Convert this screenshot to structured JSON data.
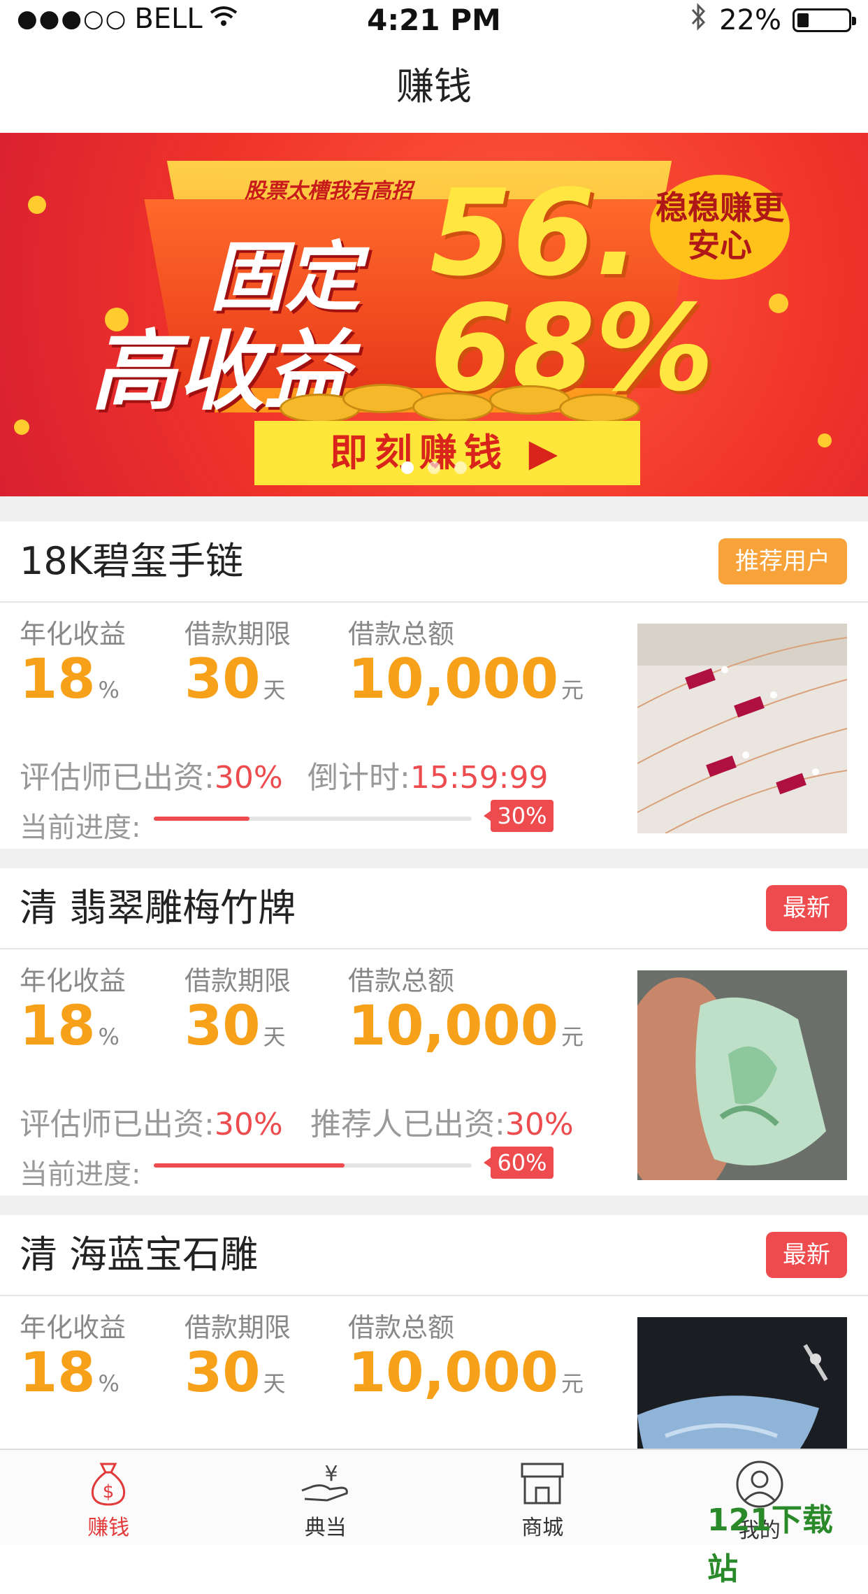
{
  "status_bar": {
    "signal": "●●●○○",
    "carrier": "BELL",
    "time": "4:21 PM",
    "battery": "22%"
  },
  "nav": {
    "title": "赚钱"
  },
  "banner": {
    "slogan": "股票太槽我有高招",
    "line1": "固定",
    "line2": "高收益",
    "rate_top": "56.",
    "rate_bottom": "68%",
    "bubble": "稳稳赚更安心",
    "button": "即刻赚钱 ▶",
    "pages": 3,
    "active_page": 0
  },
  "labels": {
    "annual_return": "年化收益",
    "loan_term": "借款期限",
    "loan_total": "借款总额",
    "progress": "当前进度:"
  },
  "products": [
    {
      "title": "18K碧玺手链",
      "tag": "推荐用户",
      "tag_color": "#f8a23a",
      "annual_return": "18",
      "annual_unit": "%",
      "term": "30",
      "term_unit": "天",
      "total": "10,000",
      "total_unit": "元",
      "info_left_label": "评估师已出资:",
      "info_left_value": "30%",
      "info_right_label": "倒计时:",
      "info_right_value": "15:59:99",
      "progress": 0.3,
      "progress_label": "30%",
      "image": "bracelet-photo"
    },
    {
      "title": "清 翡翠雕梅竹牌",
      "tag": "最新",
      "tag_color": "#ee4b4f",
      "annual_return": "18",
      "annual_unit": "%",
      "term": "30",
      "term_unit": "天",
      "total": "10,000",
      "total_unit": "元",
      "info_left_label": "评估师已出资:",
      "info_left_value": "30%",
      "info_right_label": "推荐人已出资:",
      "info_right_value": "30%",
      "progress": 0.6,
      "progress_label": "60%",
      "image": "jade-pendant-photo"
    },
    {
      "title": "清 海蓝宝石雕",
      "tag": "最新",
      "tag_color": "#ee4b4f",
      "annual_return": "18",
      "annual_unit": "%",
      "term": "30",
      "term_unit": "天",
      "total": "10,000",
      "total_unit": "元",
      "image": "aquamarine-photo"
    }
  ],
  "tabbar": {
    "items": [
      {
        "label": "赚钱",
        "icon": "money-bag-icon",
        "active": true
      },
      {
        "label": "典当",
        "icon": "hand-yen-icon",
        "active": false
      },
      {
        "label": "商城",
        "icon": "shop-icon",
        "active": false
      },
      {
        "label": "我的",
        "icon": "user-icon",
        "active": false
      }
    ]
  },
  "watermark": "121下载站",
  "colors": {
    "accent_orange": "#f7a11a",
    "accent_red": "#ee4b4f",
    "tab_active": "#e23a3a"
  }
}
